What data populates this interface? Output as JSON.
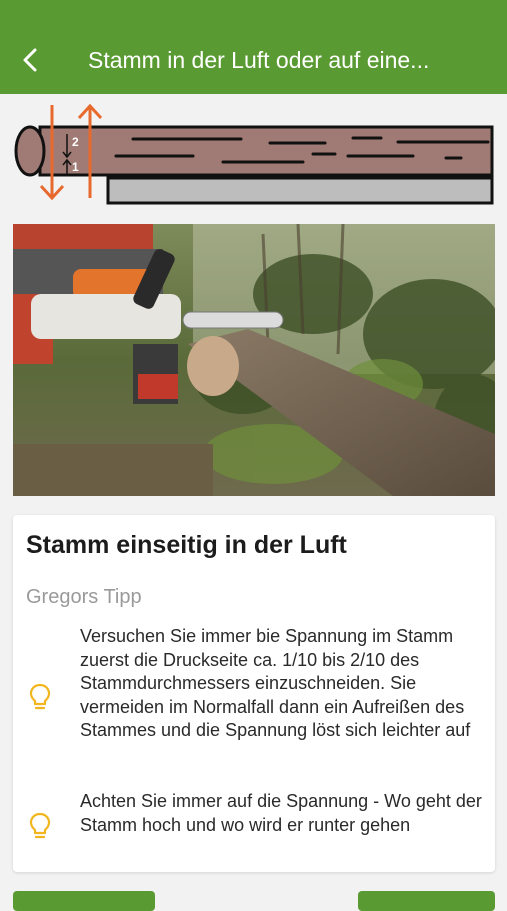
{
  "header": {
    "title": "Stamm in der Luft oder auf eine...",
    "back_icon": "chevron-left-icon",
    "color": "#5a9a32"
  },
  "diagram": {
    "labels": [
      "2",
      "1"
    ],
    "arrow_color": "#e8692e",
    "log_color": "#a07a74",
    "ground_color": "#bdbdbd"
  },
  "card": {
    "title": "Stamm einseitig in der Luft",
    "subtitle": "Gregors Tipp",
    "tips": [
      {
        "icon": "lightbulb-icon",
        "text": "Versuchen Sie immer bie Spannung im Stamm zuerst die Druckseite ca. 1/10 bis 2/10 des Stammdurchmessers einzuschneiden. Sie vermeiden im Normalfall dann ein Aufreißen des Stammes und die Spannung löst sich leichter auf"
      },
      {
        "icon": "lightbulb-icon",
        "text": "Achten Sie immer auf die Spannung - Wo geht der Stamm hoch und wo wird er runter gehen"
      }
    ]
  }
}
